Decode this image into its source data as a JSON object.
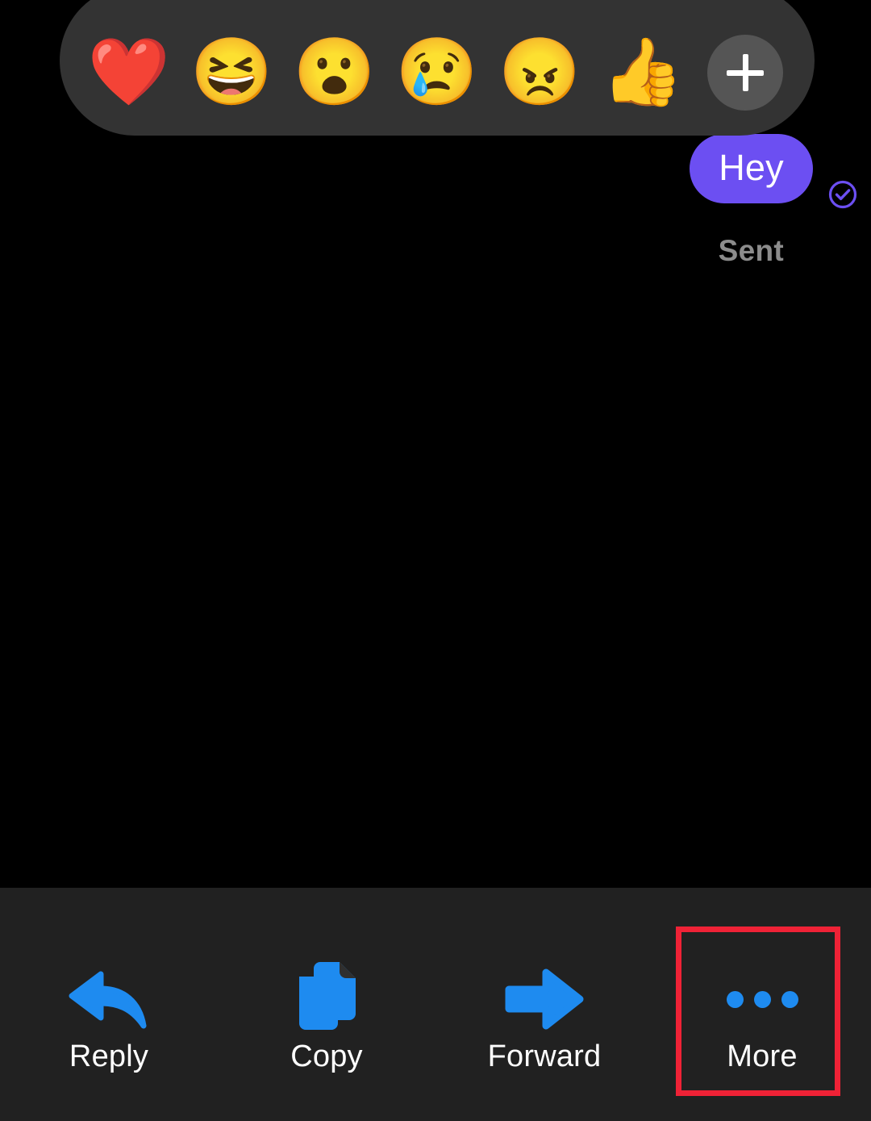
{
  "theme": {
    "background": "#000000",
    "toolbar_background": "#212121",
    "reaction_bar_background": "#333333",
    "bubble_color": "#6c4ff2",
    "icon_blue": "#1e8bf0",
    "highlight_red": "#ef2236",
    "status_text_color": "#8c8c8c"
  },
  "reaction_bar": {
    "items": [
      {
        "name": "reaction-heart",
        "emoji": "❤️",
        "label": "Love"
      },
      {
        "name": "reaction-haha",
        "emoji": "😆",
        "label": "Haha"
      },
      {
        "name": "reaction-wow",
        "emoji": "😮",
        "label": "Wow"
      },
      {
        "name": "reaction-sad",
        "emoji": "😢",
        "label": "Sad"
      },
      {
        "name": "reaction-angry",
        "emoji": "😠",
        "label": "Angry"
      },
      {
        "name": "reaction-like",
        "emoji": "👍",
        "label": "Like"
      }
    ],
    "add_button": {
      "name": "add-reaction-button",
      "icon": "plus-icon",
      "label": "+"
    }
  },
  "message": {
    "text": "Hey",
    "status": "Sent",
    "status_icon": "check-circle-icon",
    "alignment": "outgoing"
  },
  "action_toolbar": {
    "items": [
      {
        "label": "Reply",
        "icon": "reply-arrow-icon"
      },
      {
        "label": "Copy",
        "icon": "copy-documents-icon"
      },
      {
        "label": "Forward",
        "icon": "forward-arrow-icon"
      },
      {
        "label": "More",
        "icon": "three-dots-icon",
        "highlighted": true
      }
    ]
  }
}
